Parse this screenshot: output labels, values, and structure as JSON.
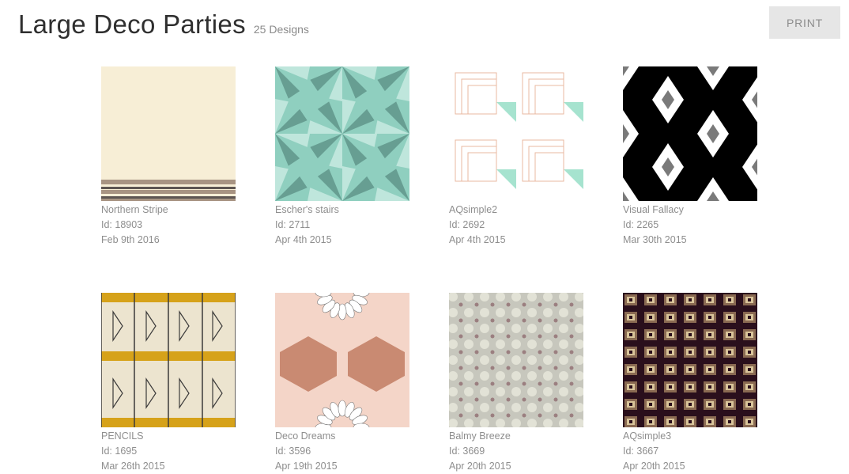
{
  "header": {
    "title": "Large Deco Parties",
    "count": "25 Designs"
  },
  "toolbar": {
    "print_label": "PRINT"
  },
  "designs": [
    {
      "name": "Northern Stripe",
      "id": "Id: 18903",
      "date": "Feb 9th 2016",
      "pattern": "northern-stripe",
      "colors": [
        "#f7eed6",
        "#a89483",
        "#5d5552"
      ]
    },
    {
      "name": "Escher's stairs",
      "id": "Id: 2711",
      "date": "Apr 4th 2015",
      "pattern": "escher-stairs",
      "colors": [
        "#8fcfbf",
        "#5a8e83",
        "#cfeee6"
      ]
    },
    {
      "name": "AQsimple2",
      "id": "Id: 2692",
      "date": "Apr 4th 2015",
      "pattern": "aqsimple2",
      "colors": [
        "#ffffff",
        "#e8b9a0",
        "#a6e3cf"
      ]
    },
    {
      "name": "Visual Fallacy",
      "id": "Id: 2265",
      "date": "Mar 30th 2015",
      "pattern": "visual-fallacy",
      "colors": [
        "#000000",
        "#ffffff",
        "#7a7a7a"
      ]
    },
    {
      "name": "PENCILS",
      "id": "Id: 1695",
      "date": "Mar 26th 2015",
      "pattern": "pencils",
      "colors": [
        "#ece4cf",
        "#d6a21a",
        "#3b3a3a"
      ]
    },
    {
      "name": "Deco Dreams",
      "id": "Id: 3596",
      "date": "Apr 19th 2015",
      "pattern": "deco-dreams",
      "colors": [
        "#f4d5c8",
        "#c98a72",
        "#ffffff"
      ]
    },
    {
      "name": "Balmy Breeze",
      "id": "Id: 3669",
      "date": "Apr 20th 2015",
      "pattern": "balmy-breeze",
      "colors": [
        "#c7c7bd",
        "#9b7f80",
        "#e2e2d6"
      ]
    },
    {
      "name": "AQsimple3",
      "id": "Id: 3667",
      "date": "Apr 20th 2015",
      "pattern": "aqsimple3",
      "colors": [
        "#2a0f1c",
        "#d9c49a",
        "#8a6a52"
      ]
    }
  ]
}
